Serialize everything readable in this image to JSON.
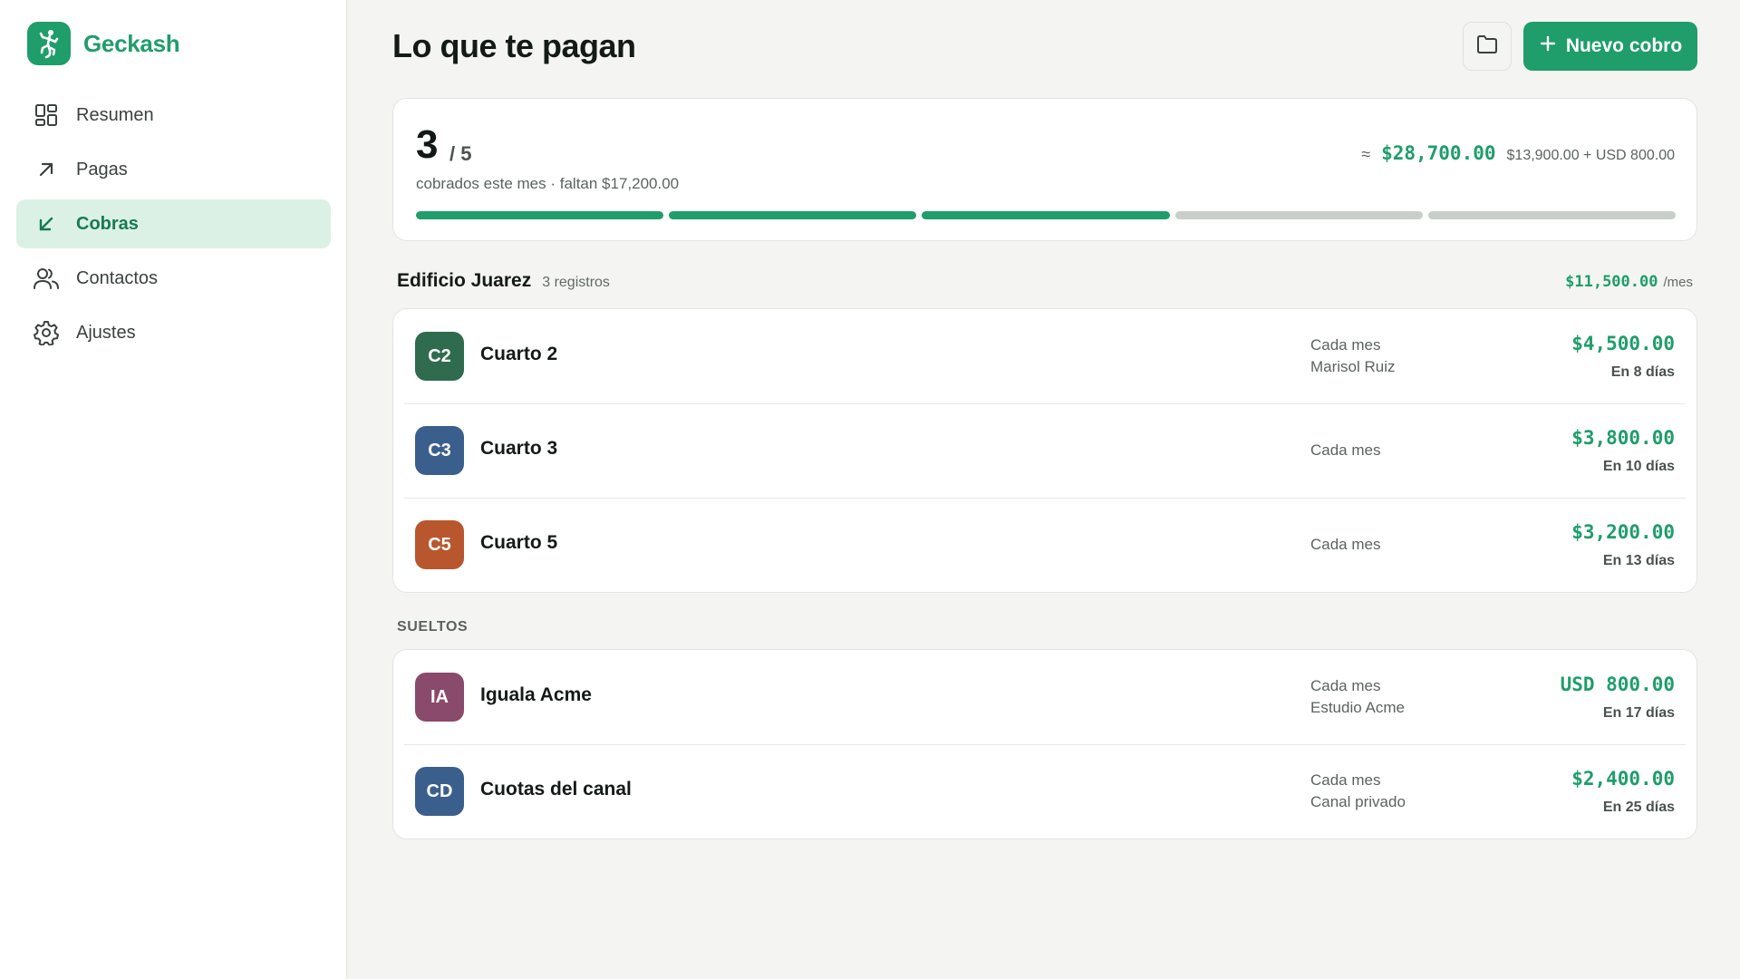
{
  "app": {
    "name": "Geckash"
  },
  "sidebar": {
    "items": [
      {
        "label": "Resumen",
        "icon": "dashboard-icon",
        "active": false
      },
      {
        "label": "Pagas",
        "icon": "arrow-up-right-icon",
        "active": false
      },
      {
        "label": "Cobras",
        "icon": "arrow-down-left-icon",
        "active": true
      },
      {
        "label": "Contactos",
        "icon": "users-icon",
        "active": false
      },
      {
        "label": "Ajustes",
        "icon": "gear-icon",
        "active": false
      }
    ]
  },
  "header": {
    "title": "Lo que te pagan",
    "new_button": "Nuevo cobro"
  },
  "summary": {
    "collected": "3",
    "total": "/ 5",
    "subtitle": "cobrados este mes · faltan $17,200.00",
    "approx_symbol": "≈",
    "approx_total": "$28,700.00",
    "breakdown": "$13,900.00 + USD 800.00",
    "segments_done": 3,
    "segments_total": 5
  },
  "group": {
    "name": "Edificio Juarez",
    "count": "3 registros",
    "total": "$11,500.00",
    "unit": "/mes",
    "rows": [
      {
        "initials": "C2",
        "color": "#2f6b4f",
        "name": "Cuarto 2",
        "frequency": "Cada mes",
        "contact": "Marisol Ruiz",
        "amount": "$4,500.00",
        "due": "En 8 días"
      },
      {
        "initials": "C3",
        "color": "#3b5f8c",
        "name": "Cuarto 3",
        "frequency": "Cada mes",
        "contact": "",
        "amount": "$3,800.00",
        "due": "En 10 días"
      },
      {
        "initials": "C5",
        "color": "#b8572e",
        "name": "Cuarto 5",
        "frequency": "Cada mes",
        "contact": "",
        "amount": "$3,200.00",
        "due": "En 13 días"
      }
    ]
  },
  "loose": {
    "label": "SUELTOS",
    "rows": [
      {
        "initials": "IA",
        "color": "#8a4a6b",
        "name": "Iguala Acme",
        "frequency": "Cada mes",
        "contact": "Estudio Acme",
        "amount": "USD 800.00",
        "due": "En 17 días"
      },
      {
        "initials": "CD",
        "color": "#3b5f8c",
        "name": "Cuotas del canal",
        "frequency": "Cada mes",
        "contact": "Canal privado",
        "amount": "$2,400.00",
        "due": "En 25 días"
      }
    ]
  }
}
